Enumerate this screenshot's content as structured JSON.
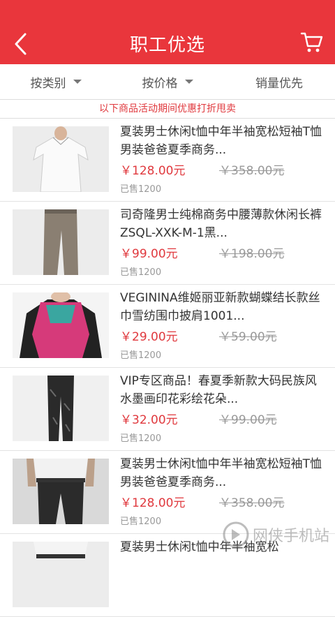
{
  "header": {
    "title": "职工优选"
  },
  "filters": [
    {
      "label": "按类别"
    },
    {
      "label": "按价格"
    },
    {
      "label": "销量优先"
    }
  ],
  "notice": "以下商品活动期间优惠打折甩卖",
  "products": [
    {
      "name": "夏装男士休闲t恤中年半袖宽松短袖T恤男装爸爸夏季商务...",
      "price": "￥128.00元",
      "original_price": "￥358.00元",
      "sold": "已售1200"
    },
    {
      "name": "司奇隆男士纯棉商务中腰薄款休闲长裤ZSQL-XXK-M-1黑...",
      "price": "￥99.00元",
      "original_price": "￥198.00元",
      "sold": "已售1200"
    },
    {
      "name": "VEGININA维姬丽亚新款蝴蝶结长款丝巾雪纺围巾披肩1001...",
      "price": "￥29.00元",
      "original_price": "￥59.00元",
      "sold": "已售1200"
    },
    {
      "name": "VIP专区商品！春夏季新款大码民族风水墨画印花彩绘花朵...",
      "price": "￥32.00元",
      "original_price": "￥99.00元",
      "sold": "已售1200"
    },
    {
      "name": "夏装男士休闲t恤中年半袖宽松短袖T恤男装爸爸夏季商务...",
      "price": "￥128.00元",
      "original_price": "￥358.00元",
      "sold": "已售1200"
    },
    {
      "name": "夏装男士休闲t恤中年半袖宽松",
      "price": "",
      "original_price": "",
      "sold": ""
    }
  ],
  "watermark": "网侠手机站",
  "colors": {
    "brand_red": "#e9363c",
    "price_red": "#e0393e"
  }
}
